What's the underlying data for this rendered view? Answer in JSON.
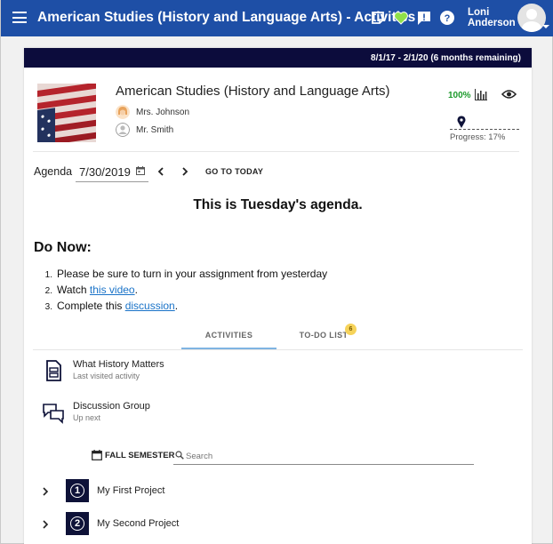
{
  "topbar": {
    "title": "American Studies (History and Language Arts) - Activities",
    "user_name": "Loni Anderson",
    "user_first": "Loni",
    "user_last": "Anderson",
    "accent_color": "#1e4fa6",
    "icons": [
      "menu-icon",
      "notes-icon",
      "heart-icon",
      "feedback-icon",
      "help-icon",
      "avatar"
    ]
  },
  "course": {
    "date_range": "8/1/17 - 2/1/20 (6 months remaining)",
    "title": "American Studies (History and Language Arts)",
    "teachers": [
      "Mrs. Johnson",
      "Mr. Smith"
    ],
    "completion": "100%",
    "progress_text": "Progress: 17%",
    "progress_value": 0.17
  },
  "agenda": {
    "label": "Agenda",
    "date": "7/30/2019",
    "go_to_today": "GO TO TODAY",
    "heading": "This is Tuesday's agenda.",
    "do_now": "Do Now:",
    "items": [
      {
        "num": "1.",
        "text": "Please be sure to turn in your assignment from yesterday",
        "link": "",
        "after": ""
      },
      {
        "num": "2.",
        "text": "Watch ",
        "link": "this video",
        "after": "."
      },
      {
        "num": "3.",
        "text": "Complete this ",
        "link": "discussion",
        "after": "."
      }
    ]
  },
  "tabs": {
    "activities": "ACTIVITIES",
    "todo": "TO-DO LIST",
    "todo_count": "6"
  },
  "activities": [
    {
      "title": "What History Matters",
      "subtitle": "Last visited activity"
    },
    {
      "title": "Discussion Group",
      "subtitle": "Up next"
    }
  ],
  "filter": {
    "semester": "FALL SEMESTER",
    "search_placeholder": "Search"
  },
  "projects": [
    {
      "number": "1",
      "title": "My First Project"
    },
    {
      "number": "2",
      "title": "My Second Project"
    }
  ]
}
